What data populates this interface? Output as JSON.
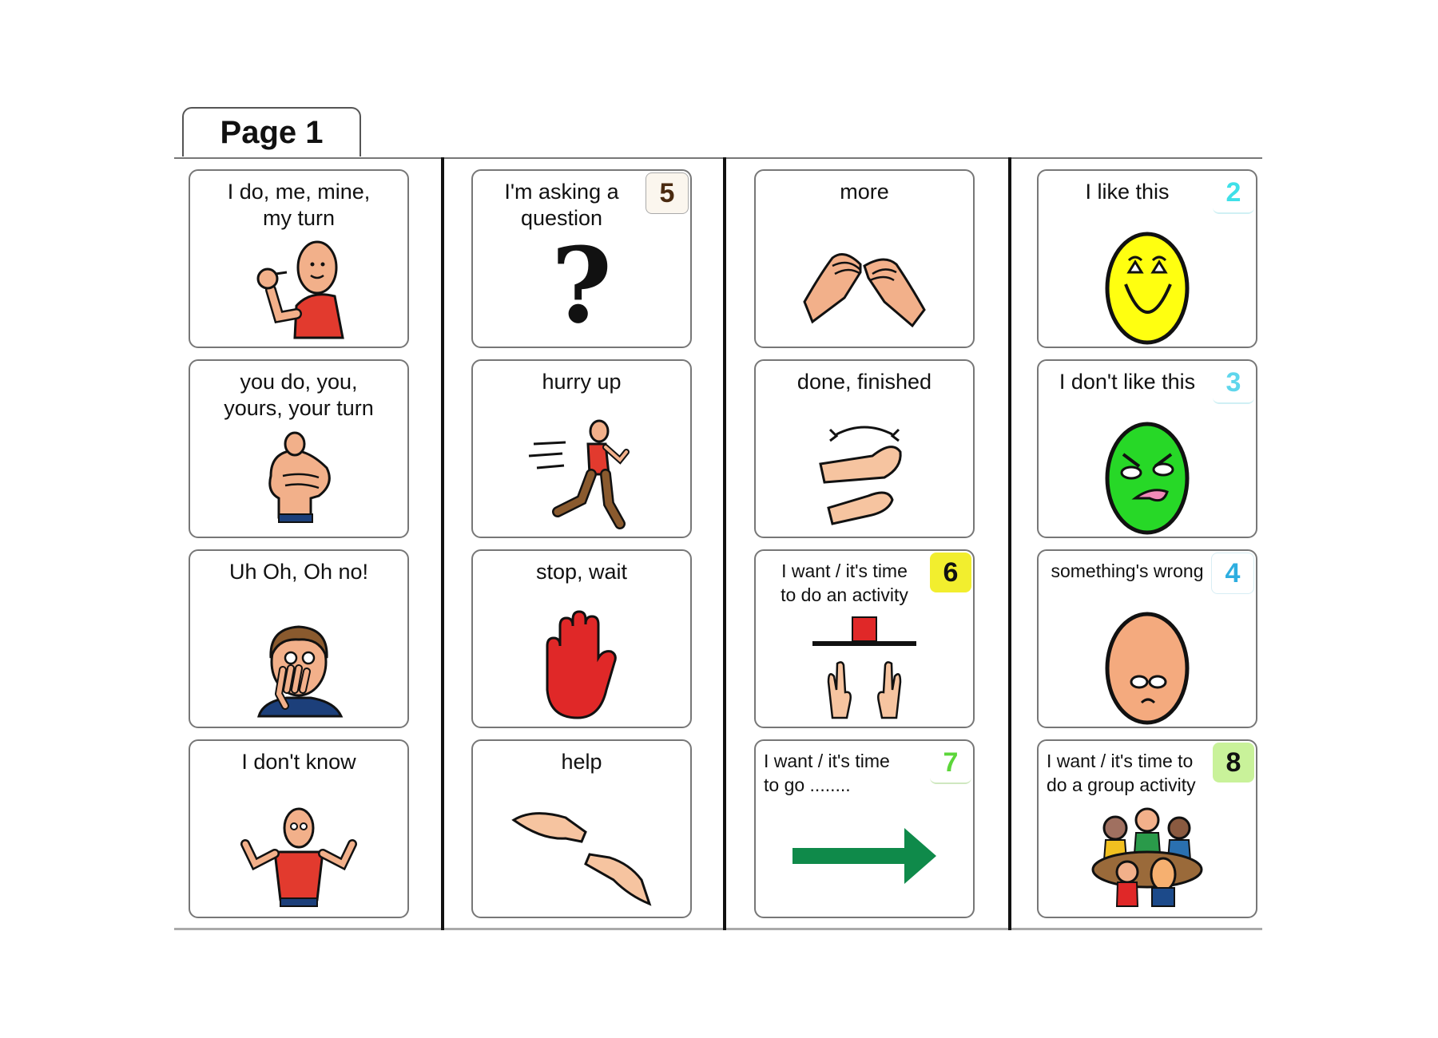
{
  "page_label": "Page 1",
  "colors": {
    "badge_5_bg": "#fbf6ee",
    "badge_5_fg": "#4a2a10",
    "badge_2_fg": "#3fe0e8",
    "badge_3_fg": "#5fd6ec",
    "badge_4_fg": "#2eaee0",
    "badge_6_bg": "#f2ee2e",
    "badge_6_fg": "#111111",
    "badge_7_fg": "#5cd63a",
    "badge_8_bg": "#c9f29a",
    "badge_8_fg": "#111111"
  },
  "columns": [
    {
      "cards": [
        {
          "label": "I do, me, mine,\nmy turn",
          "icon": "thumb-to-self-icon"
        },
        {
          "label": "you do, you,\nyours, your turn",
          "icon": "pointing-finger-icon"
        },
        {
          "label": "Uh Oh, Oh no!",
          "icon": "hand-over-mouth-icon"
        },
        {
          "label": "I don't know",
          "icon": "shrug-icon"
        }
      ]
    },
    {
      "cards": [
        {
          "label": "I'm asking a\nquestion",
          "badge": "5",
          "icon": "question-mark-icon"
        },
        {
          "label": "hurry up",
          "icon": "running-person-icon"
        },
        {
          "label": "stop,  wait",
          "icon": "stop-hand-icon"
        },
        {
          "label": "help",
          "icon": "helping-hands-icon"
        }
      ]
    },
    {
      "cards": [
        {
          "label": "more",
          "icon": "more-sign-hands-icon"
        },
        {
          "label": "done, finished",
          "icon": "finished-sign-hands-icon"
        },
        {
          "label": "I want / it's time\nto do an activity",
          "badge": "6",
          "icon": "activity-icon"
        },
        {
          "label": "I want / it's time\nto go ........",
          "badge": "7",
          "icon": "green-arrow-right-icon"
        }
      ]
    },
    {
      "cards": [
        {
          "label": "I like this",
          "badge": "2",
          "icon": "happy-face-icon"
        },
        {
          "label": "I don't like this",
          "badge": "3",
          "icon": "disgusted-face-icon"
        },
        {
          "label": "something's wrong",
          "badge": "4",
          "icon": "sad-face-icon"
        },
        {
          "label": "I want / it's time to\ndo a group activity",
          "badge": "8",
          "icon": "group-activity-icon"
        }
      ]
    }
  ]
}
